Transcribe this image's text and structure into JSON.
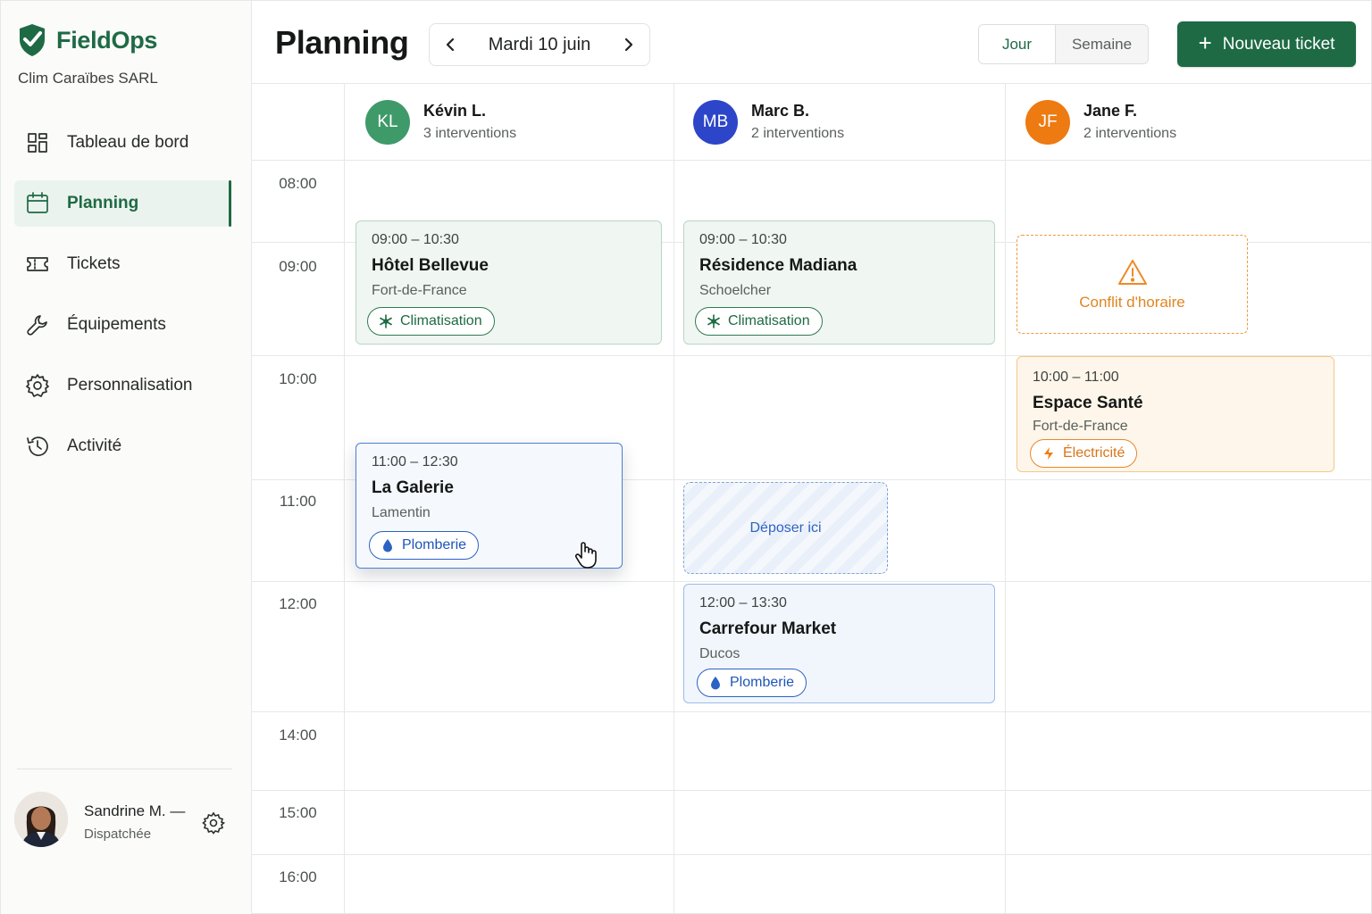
{
  "app": {
    "name": "FieldOps",
    "company": "Clim Caraïbes SARL",
    "brand_color": "#1e6a44"
  },
  "sidebar": {
    "items": [
      {
        "label": "Tableau de bord",
        "icon": "dashboard-icon"
      },
      {
        "label": "Planning",
        "icon": "calendar-icon",
        "active": true
      },
      {
        "label": "Tickets",
        "icon": "ticket-icon"
      },
      {
        "label": "Équipements",
        "icon": "wrench-icon"
      },
      {
        "label": "Personnalisation",
        "icon": "gear-icon"
      },
      {
        "label": "Activité",
        "icon": "history-icon"
      }
    ],
    "user": {
      "name": "Sandrine M. —",
      "role": "Dispatchée"
    }
  },
  "header": {
    "title": "Planning",
    "date": "Mardi 10 juin",
    "view_day": "Jour",
    "view_week": "Semaine",
    "active_view": "Jour",
    "new_ticket": "Nouveau ticket"
  },
  "calendar": {
    "times": [
      "08:00",
      "09:00",
      "10:00",
      "11:00",
      "12:00",
      "14:00",
      "15:00",
      "16:00"
    ],
    "technicians": [
      {
        "initials": "KL",
        "name": "Kévin L.",
        "count": "3 interventions",
        "color": "#3f9a6a"
      },
      {
        "initials": "MB",
        "name": "Marc B.",
        "count": "2 interventions",
        "color": "#2d45c8"
      },
      {
        "initials": "JF",
        "name": "Jane F.",
        "count": "2 interventions",
        "color": "#ee7a12"
      }
    ],
    "events": [
      {
        "time": "09:00 – 10:30",
        "title": "Hôtel Bellevue",
        "location": "Fort-de-France",
        "tag": "Climatisation",
        "tag_icon": "snowflake-icon"
      },
      {
        "time": "09:00 – 10:30",
        "title": "Résidence Madiana",
        "location": "Schoelcher",
        "tag": "Climatisation",
        "tag_icon": "snowflake-icon"
      },
      {
        "time": "10:00 – 11:00",
        "title": "Espace Santé",
        "location": "Fort-de-France",
        "tag": "Électricité",
        "tag_icon": "lightning-icon"
      },
      {
        "time": "11:00 – 12:30",
        "title": "La Galerie",
        "location": "Lamentin",
        "tag": "Plomberie",
        "tag_icon": "drop-icon",
        "dragging": true
      },
      {
        "time": "12:00 – 13:30",
        "title": "Carrefour Market",
        "location": "Ducos",
        "tag": "Plomberie",
        "tag_icon": "drop-icon"
      }
    ],
    "conflict_label": "Conflit d'horaire",
    "dropzone_label": "Déposer ici"
  }
}
